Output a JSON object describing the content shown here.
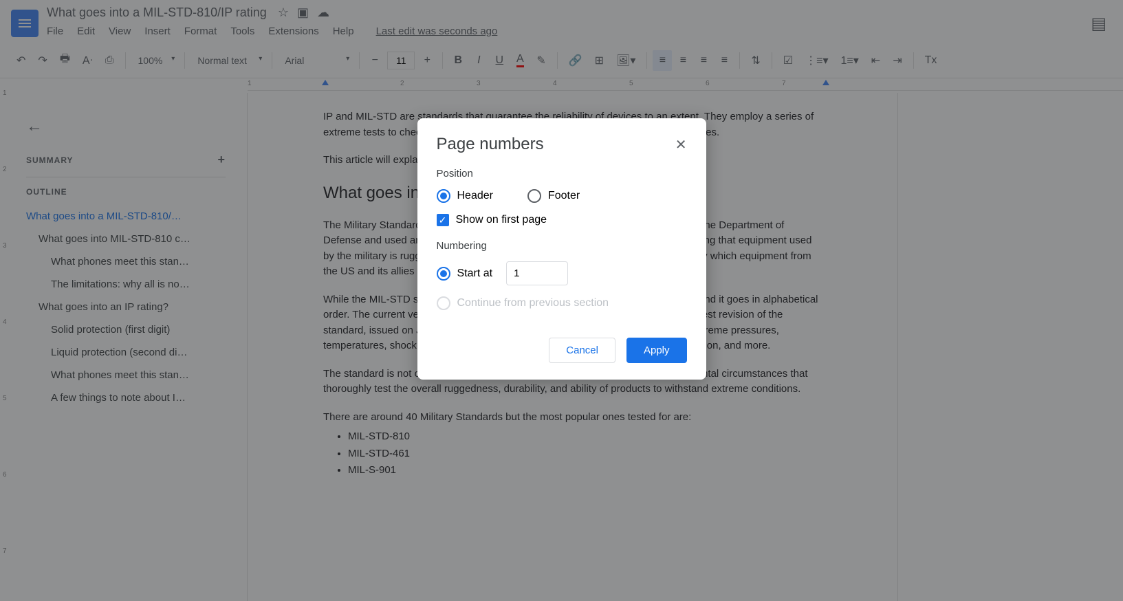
{
  "header": {
    "doc_title": "What goes into a MIL-STD-810/IP rating",
    "last_edit": "Last edit was seconds ago"
  },
  "menubar": [
    "File",
    "Edit",
    "View",
    "Insert",
    "Format",
    "Tools",
    "Extensions",
    "Help"
  ],
  "toolbar": {
    "zoom": "100%",
    "style": "Normal text",
    "font": "Arial",
    "font_size": "11"
  },
  "ruler": [
    "1",
    "2",
    "3",
    "4",
    "5",
    "6",
    "7"
  ],
  "outline": {
    "summary_label": "SUMMARY",
    "outline_label": "OUTLINE",
    "items": [
      {
        "level": 1,
        "text": "What goes into a MIL-STD-810/…"
      },
      {
        "level": 2,
        "text": "What goes into MIL-STD-810 c…"
      },
      {
        "level": 3,
        "text": "What phones meet this stan…"
      },
      {
        "level": 3,
        "text": "The limitations: why all is no…"
      },
      {
        "level": 2,
        "text": "What goes into an IP rating?"
      },
      {
        "level": 3,
        "text": "Solid protection (first digit)"
      },
      {
        "level": 3,
        "text": "Liquid protection (second di…"
      },
      {
        "level": 3,
        "text": "What phones meet this stan…"
      },
      {
        "level": 3,
        "text": "A few things to note about I…"
      }
    ]
  },
  "document": {
    "p1": "IP and MIL-STD are standards that guarantee the reliability of devices to an extent. They employ a series of extreme tests to check the ruggedness, performance, and general reliability of devices.",
    "p2": "This article will explain what goes into each rating and what they mean.",
    "h2": "What goes into MIL-STD-810",
    "p3": "The Military Standard (written MIL-STD) is a standard developed and published by the Department of Defense and used around the world. It was created for the obvious reason of ensuring that equipment used by the military is rugged and battlefield capable. It also helps to create a standard by which equipment from the US and its allies can be compared.",
    "p4": "While the MIL-STD stands for Military Standard, 810 refers to the current revision, and it goes in alphabetical order. The current version is MIL-STD-810H. Version H represents the ninth and latest revision of the standard, issued on January 31, 2019. It explains how to test equipment against extreme pressures, temperatures, shock, contamination by fluids, and acidic atmosphere, fungus, vibration, and more.",
    "p5": "The standard is not only useful for military equipment, as it covers many environmental circumstances that thoroughly test the overall ruggedness, durability, and ability of products to withstand extreme conditions.",
    "p6": "There are around 40 Military Standards but the most popular ones tested for are:",
    "list": [
      "MIL-STD-810",
      "MIL-STD-461",
      "MIL-S-901"
    ]
  },
  "dialog": {
    "title": "Page numbers",
    "position_label": "Position",
    "header_label": "Header",
    "footer_label": "Footer",
    "show_first_label": "Show on first page",
    "numbering_label": "Numbering",
    "start_at_label": "Start at",
    "start_at_value": "1",
    "continue_label": "Continue from previous section",
    "cancel": "Cancel",
    "apply": "Apply"
  }
}
